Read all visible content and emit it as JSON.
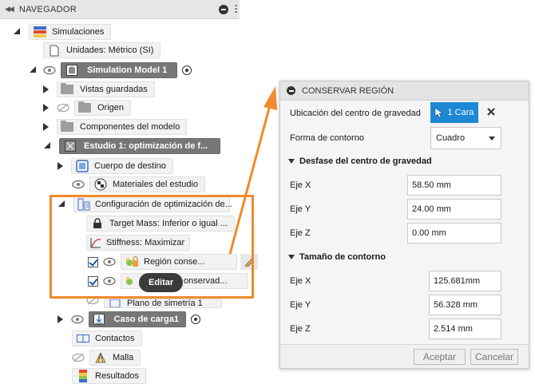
{
  "browser": {
    "title": "NAVEGADOR",
    "items": {
      "simulations": "Simulaciones",
      "units": "Unidades: Métrico (SI)",
      "model": "Simulation Model 1",
      "named_views": "Vistas guardadas",
      "origin": "Origen",
      "model_components": "Componentes del modelo",
      "study": "Estudio 1: optimización de f...",
      "target_body": "Cuerpo de destino",
      "study_materials": "Materiales del estudio",
      "opt_setup": "Configuración de optimización de...",
      "target_mass": "Target Mass: Inferior o igual ...",
      "stiffness": "Stiffness: Maximizar",
      "preserve_region": "Región conse...",
      "preserve_region2": "onservad...",
      "symmetry_plane": "Plano de simetría 1",
      "load_case": "Caso de carga1",
      "contacts": "Contactos",
      "mesh": "Malla",
      "results": "Resultados"
    }
  },
  "tooltip": "Editar",
  "dialog": {
    "title": "CONSERVAR REGIÓN",
    "centroid_label": "Ubicación del centro de gravedad",
    "selection_button": "1 Cara",
    "shape_label": "Forma de contorno",
    "shape_value": "Cuadro",
    "offset_section": "Desfase del centro de gravedad",
    "offset": {
      "x_label": "Eje X",
      "x_value": "58.50 mm",
      "y_label": "Eje Y",
      "y_value": "24.00 mm",
      "z_label": "Eje Z",
      "z_value": "0.00 mm"
    },
    "size_section": "Tamaño de contorno",
    "size": {
      "x_label": "Eje X",
      "x_value": "125.681mm",
      "y_label": "Eje Y",
      "y_value": "56.328 mm",
      "z_label": "Eje Z",
      "z_value": "2.514 mm"
    },
    "ok_label": "Aceptar",
    "cancel_label": "Cancelar"
  },
  "colors": {
    "highlight": "#f08a2c",
    "select_blue": "#1e88d4",
    "dark_node": "#777777"
  }
}
